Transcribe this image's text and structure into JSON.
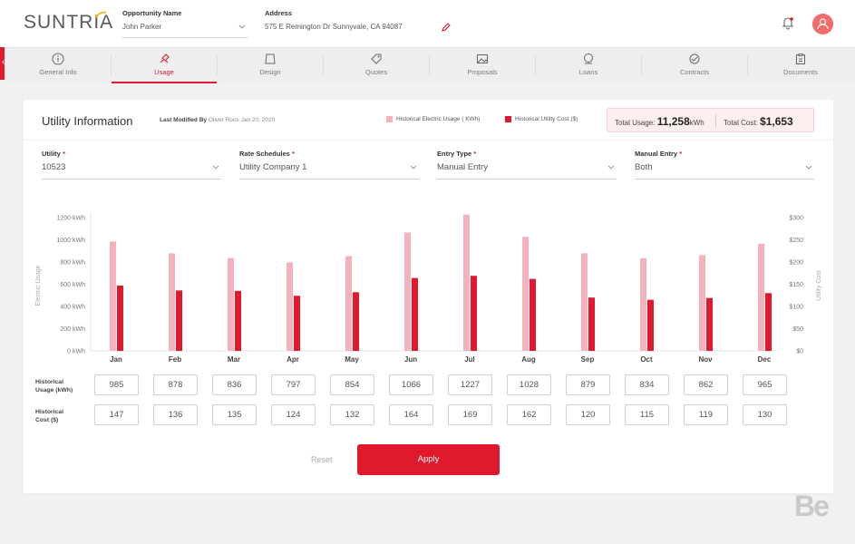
{
  "header": {
    "logo": "SUNTRIA",
    "opportunity_label": "Opportunity Name",
    "opportunity_value": "John Parker",
    "address_label": "Address",
    "address_value": "575 E Remington Dr Sunnyvale, CA 94087"
  },
  "tabs": [
    {
      "label": "General Info",
      "icon": "info-icon",
      "active": false
    },
    {
      "label": "Usage",
      "icon": "usage-icon",
      "active": true
    },
    {
      "label": "Design",
      "icon": "design-icon",
      "active": false
    },
    {
      "label": "Quotes",
      "icon": "tag-icon",
      "active": false
    },
    {
      "label": "Proposals",
      "icon": "image-icon",
      "active": false
    },
    {
      "label": "Loans",
      "icon": "loan-icon",
      "active": false
    },
    {
      "label": "Contracts",
      "icon": "contract-icon",
      "active": false
    },
    {
      "label": "Documents",
      "icon": "clipboard-icon",
      "active": false
    }
  ],
  "card": {
    "title": "Utility Information",
    "modified_by_label": "Last Modified By",
    "modified_by_name": "Oliver Roos",
    "modified_date": "Jan 20, 2020",
    "legend_usage": "Historical Electric Usage ( KWh)",
    "legend_cost": "Historical Utility Cost ($)",
    "total_usage_label": "Total Usage:",
    "total_usage_value": "11,258",
    "total_usage_unit": "kWh",
    "total_cost_label": "Total Cost:",
    "total_cost_value": "$1,653"
  },
  "selects": [
    {
      "label": "Utility",
      "value": "10523"
    },
    {
      "label": "Rate Schedules",
      "value": "Utility Company 1"
    },
    {
      "label": "Entry Type",
      "value": "Manual Entry"
    },
    {
      "label": "Manual Entry",
      "value": "Both"
    }
  ],
  "rows": {
    "usage_label_1": "Historical",
    "usage_label_2": "Usage (kWh)",
    "cost_label_1": "Historical",
    "cost_label_2": "Cost ($)"
  },
  "actions": {
    "reset": "Reset",
    "apply": "Apply"
  },
  "watermark": "Be",
  "colors": {
    "accent": "#e0192e",
    "usage_bar": "#f4b3bc",
    "cost_bar": "#e0192e"
  },
  "chart_data": {
    "type": "bar",
    "categories": [
      "Jan",
      "Feb",
      "Mar",
      "Apr",
      "May",
      "Jun",
      "Jul",
      "Aug",
      "Sep",
      "Oct",
      "Nov",
      "Dec"
    ],
    "series": [
      {
        "name": "Historical Electric Usage ( KWh)",
        "axis": "left",
        "values": [
          985,
          878,
          836,
          797,
          854,
          1066,
          1227,
          1028,
          879,
          834,
          862,
          965
        ]
      },
      {
        "name": "Historical Utility Cost ($)",
        "axis": "right",
        "values": [
          147,
          136,
          135,
          124,
          132,
          164,
          169,
          162,
          120,
          115,
          119,
          130
        ]
      }
    ],
    "ylabel_left": "Electric Usage",
    "ylabel_right": "Utility Cost",
    "ylim_left": [
      0,
      1200
    ],
    "ylim_right": [
      0,
      300
    ],
    "yticks_left": [
      "0 kWh",
      "200 kWh",
      "400 kWh",
      "600 kWh",
      "800 kWh",
      "1000 kWh",
      "1200 kWh"
    ],
    "yticks_right": [
      "$0",
      "$50",
      "$100",
      "$150",
      "$200",
      "$250",
      "$300"
    ],
    "grid": false
  }
}
